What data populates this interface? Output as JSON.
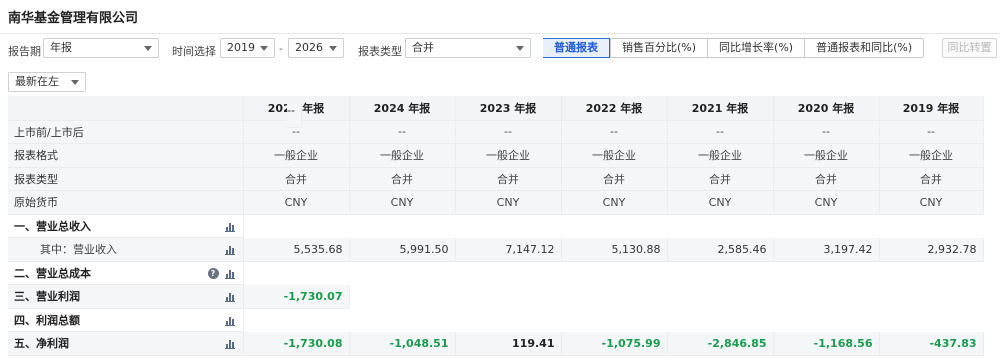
{
  "header": {
    "company": "南华基金管理有限公司"
  },
  "filters": {
    "report_period_label": "报告期",
    "report_period_value": "年报",
    "time_label": "时间选择",
    "year_from": "2019",
    "year_to": "2026",
    "dash": "-",
    "report_type_label": "报表类型",
    "report_type_value": "合并",
    "tabs": [
      "普通报表",
      "销售百分比(%)",
      "同比增长率(%)",
      "普通报表和同比(%)"
    ],
    "compare_button": "同比转置",
    "sort_value": "最新在左"
  },
  "table": {
    "columns": [
      "2025 年报",
      "2024 年报",
      "2023 年报",
      "2022 年报",
      "2021 年报",
      "2020 年报",
      "2019 年报"
    ],
    "rows": [
      {
        "label": "上市前/上市后",
        "values": [
          "--",
          "--",
          "--",
          "--",
          "--",
          "--",
          "--"
        ],
        "style": "center"
      },
      {
        "label": "报表格式",
        "values": [
          "一般企业",
          "一般企业",
          "一般企业",
          "一般企业",
          "一般企业",
          "一般企业",
          "一般企业"
        ],
        "style": "center"
      },
      {
        "label": "报表类型",
        "values": [
          "合并",
          "合并",
          "合并",
          "合并",
          "合并",
          "合并",
          "合并"
        ],
        "style": "center"
      },
      {
        "label": "原始货币",
        "values": [
          "CNY",
          "CNY",
          "CNY",
          "CNY",
          "CNY",
          "CNY",
          "CNY"
        ],
        "style": "center"
      },
      {
        "label": "一、营业总收入",
        "values": [
          "--",
          "--",
          "--",
          "--",
          "--",
          "--",
          "--"
        ],
        "style": "num",
        "bold": true,
        "chart": true
      },
      {
        "label": "其中：营业收入",
        "values": [
          "5,535.68",
          "5,991.50",
          "7,147.12",
          "5,130.88",
          "2,585.46",
          "3,197.42",
          "2,932.78"
        ],
        "style": "num",
        "sub": true,
        "chart": true
      },
      {
        "label": "二、营业总成本",
        "values": [
          "--",
          "--",
          "--",
          "--",
          "--",
          "--",
          "--"
        ],
        "style": "num",
        "bold": true,
        "chart": true,
        "help": true
      },
      {
        "label": "三、营业利润",
        "values": [
          "-1,730.07",
          "--",
          "--",
          "--",
          "--",
          "--",
          "--"
        ],
        "style": "num",
        "bold": true,
        "chart": true
      },
      {
        "label": "四、利润总额",
        "values": [
          "--",
          "--",
          "--",
          "--",
          "--",
          "--",
          "--"
        ],
        "style": "num",
        "bold": true,
        "chart": true
      },
      {
        "label": "五、净利润",
        "values": [
          "-1,730.08",
          "-1,048.51",
          "119.41",
          "-1,075.99",
          "-2,846.85",
          "-1,168.56",
          "-437.83"
        ],
        "style": "num",
        "bold": true,
        "chart": true
      }
    ]
  },
  "colors": {
    "negative": "#1a9a4e",
    "active_tab": "#1d5bd6",
    "header_bg": "#f2f4f7"
  }
}
